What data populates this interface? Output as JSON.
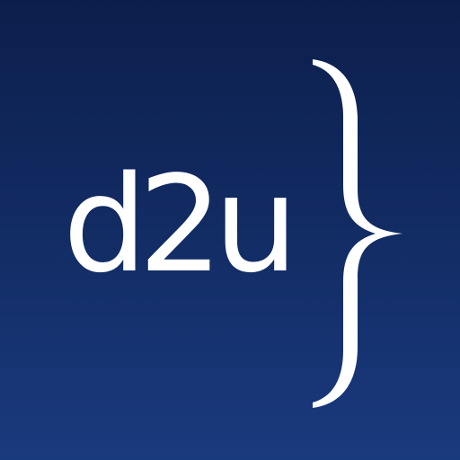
{
  "logo": {
    "text": "d2u",
    "symbol": "closing-curly-brace",
    "text_color": "#ffffff",
    "background_top": "#0c1f4c",
    "background_bottom": "#1a3a7e"
  }
}
